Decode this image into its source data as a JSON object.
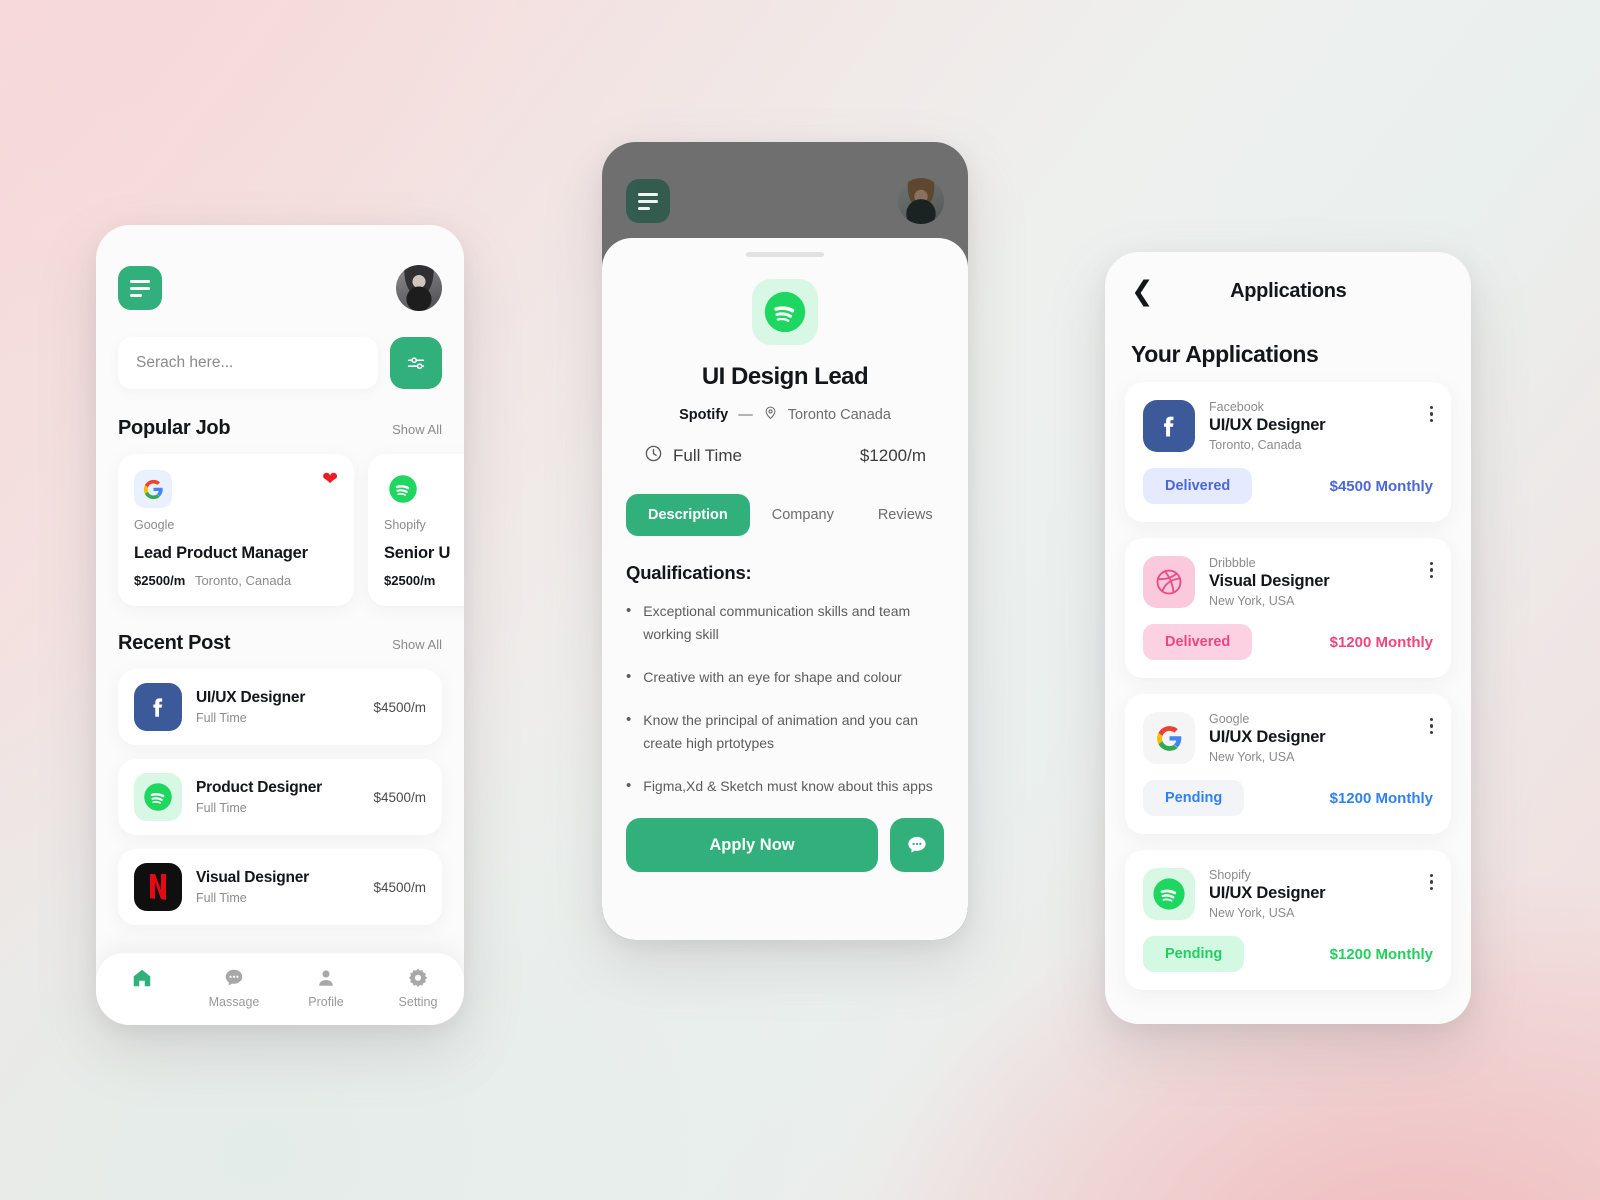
{
  "theme": {
    "accent_green": "#32b07b",
    "blue": "#4a68d6",
    "pink": "#f1457f",
    "light_blue": "#2f82f0",
    "green_status": "#23cf5f",
    "heart_red": "#ed1c24"
  },
  "home": {
    "menu_icon": "hamburger-menu-icon",
    "avatar_icon": "user-avatar",
    "search": {
      "value": "",
      "placeholder": "Serach here..."
    },
    "filter_icon": "filter-sliders-icon",
    "popular": {
      "title": "Popular Job",
      "show_all": "Show All",
      "cards": [
        {
          "company": "Google",
          "logo": "google-logo",
          "title": "Lead Product Manager",
          "pay": "$2500/m",
          "location": "Toronto, Canada",
          "favorited": true,
          "heart_icon": "heart-filled-icon"
        },
        {
          "company": "Shopify",
          "logo": "spotify-logo",
          "title": "Senior U",
          "pay": "$2500/m",
          "location": "",
          "favorited": false
        }
      ]
    },
    "recent": {
      "title": "Recent Post",
      "show_all": "Show All",
      "posts": [
        {
          "logo": "facebook-logo",
          "title": "UI/UX Designer",
          "type": "Full Time",
          "pay": "$4500/m"
        },
        {
          "logo": "spotify-logo",
          "title": "Product Designer",
          "type": "Full Time",
          "pay": "$4500/m"
        },
        {
          "logo": "netflix-logo",
          "title": "Visual Designer",
          "type": "Full Time",
          "pay": "$4500/m"
        }
      ]
    },
    "tabbar": [
      {
        "icon": "home-icon",
        "label": "",
        "active": true
      },
      {
        "icon": "message-bubble-icon",
        "label": "Massage",
        "active": false
      },
      {
        "icon": "profile-person-icon",
        "label": "Profile",
        "active": false
      },
      {
        "icon": "settings-gear-icon",
        "label": "Setting",
        "active": false
      }
    ]
  },
  "detail": {
    "menu_icon": "hamburger-menu-icon",
    "avatar_icon": "user-avatar",
    "logo": "spotify-logo",
    "job_title": "UI Design Lead",
    "company": "Spotify",
    "separator": "—",
    "location_icon": "location-pin-icon",
    "location": "Toronto Canada",
    "clock_icon": "clock-icon",
    "employment_type": "Full Time",
    "pay": "$1200/m",
    "tabs": [
      {
        "label": "Description",
        "active": true
      },
      {
        "label": "Company",
        "active": false
      },
      {
        "label": "Reviews",
        "active": false
      }
    ],
    "qualifications_heading": "Qualifications:",
    "qualifications": [
      "Exceptional communication skills and team working skill",
      "Creative with an eye for shape and colour",
      "Know the principal of animation and you can create high prtotypes",
      "Figma,Xd & Sketch must know about this apps"
    ],
    "apply_label": "Apply Now",
    "chat_icon": "chat-bubble-icon"
  },
  "applications": {
    "back_icon": "chevron-left-icon",
    "header_title": "Applications",
    "section_title": "Your Applications",
    "menu_icon": "kebab-menu-icon",
    "items": [
      {
        "logo": "facebook-logo",
        "company": "Facebook",
        "role": "UI/UX Designer",
        "location": "Toronto, Canada",
        "status": "Delivered",
        "pay": "$4500 Monthly",
        "status_class": "s-blue",
        "pay_class": "p-blue",
        "logo_class": "fb"
      },
      {
        "logo": "dribbble-logo",
        "company": "Dribbble",
        "role": "Visual Designer",
        "location": "New York, USA",
        "status": "Delivered",
        "pay": "$1200 Monthly",
        "status_class": "s-pink",
        "pay_class": "p-pink",
        "logo_class": "dribbble"
      },
      {
        "logo": "google-logo",
        "company": "Google",
        "role": "UI/UX Designer",
        "location": "New York, USA",
        "status": "Pending",
        "pay": "$1200 Monthly",
        "status_class": "s-lblue",
        "pay_class": "p-lblue",
        "logo_class": "google"
      },
      {
        "logo": "spotify-logo",
        "company": "Shopify",
        "role": "UI/UX Designer",
        "location": "New York, USA",
        "status": "Pending",
        "pay": "$1200 Monthly",
        "status_class": "s-green",
        "pay_class": "p-green",
        "logo_class": "spotify"
      }
    ]
  }
}
